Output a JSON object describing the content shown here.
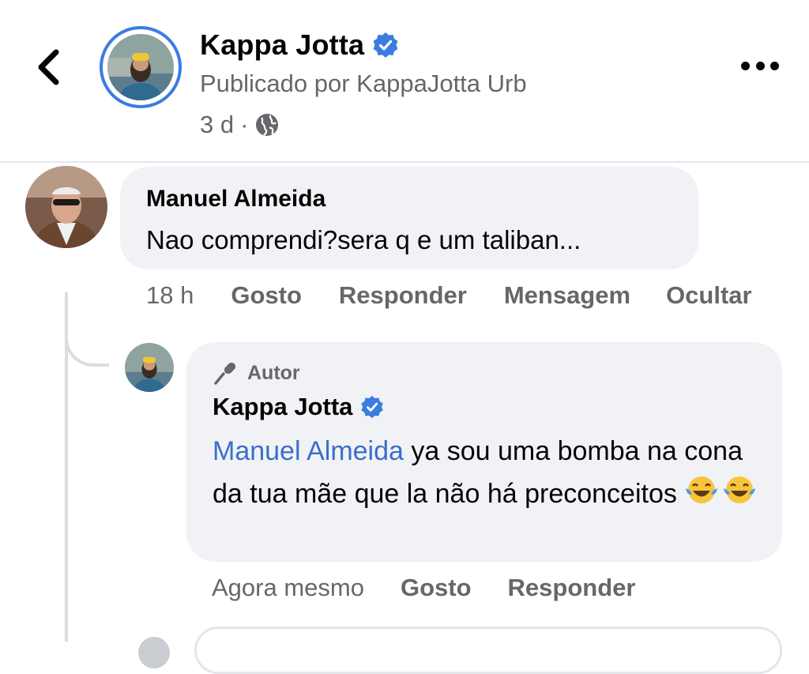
{
  "post_header": {
    "page_name": "Kappa Jotta",
    "published_by": "Publicado por KappaJotta Urb",
    "time": "3 d",
    "separator": "·",
    "verified_icon": "verified-badge-icon",
    "privacy_icon": "globe-icon"
  },
  "comment": {
    "author": "Manuel Almeida",
    "text": "Nao comprendi?sera q e um taliban...",
    "time": "18 h",
    "actions": [
      "Gosto",
      "Responder",
      "Mensagem",
      "Ocultar"
    ]
  },
  "reply": {
    "badge": "Autor",
    "author": "Kappa Jotta",
    "mention": "Manuel Almeida",
    "text": " ya sou uma bomba na cona da tua mãe que la não há preconceitos ",
    "emojis": [
      "face-with-tears-of-joy",
      "face-with-tears-of-joy"
    ],
    "time": "Agora mesmo",
    "actions": [
      "Gosto",
      "Responder"
    ]
  },
  "colors": {
    "accent_blue": "#3b7ce0",
    "mention_blue": "#3b6ec9",
    "bubble_bg": "#f0f2f5",
    "secondary_text": "#65676b"
  }
}
